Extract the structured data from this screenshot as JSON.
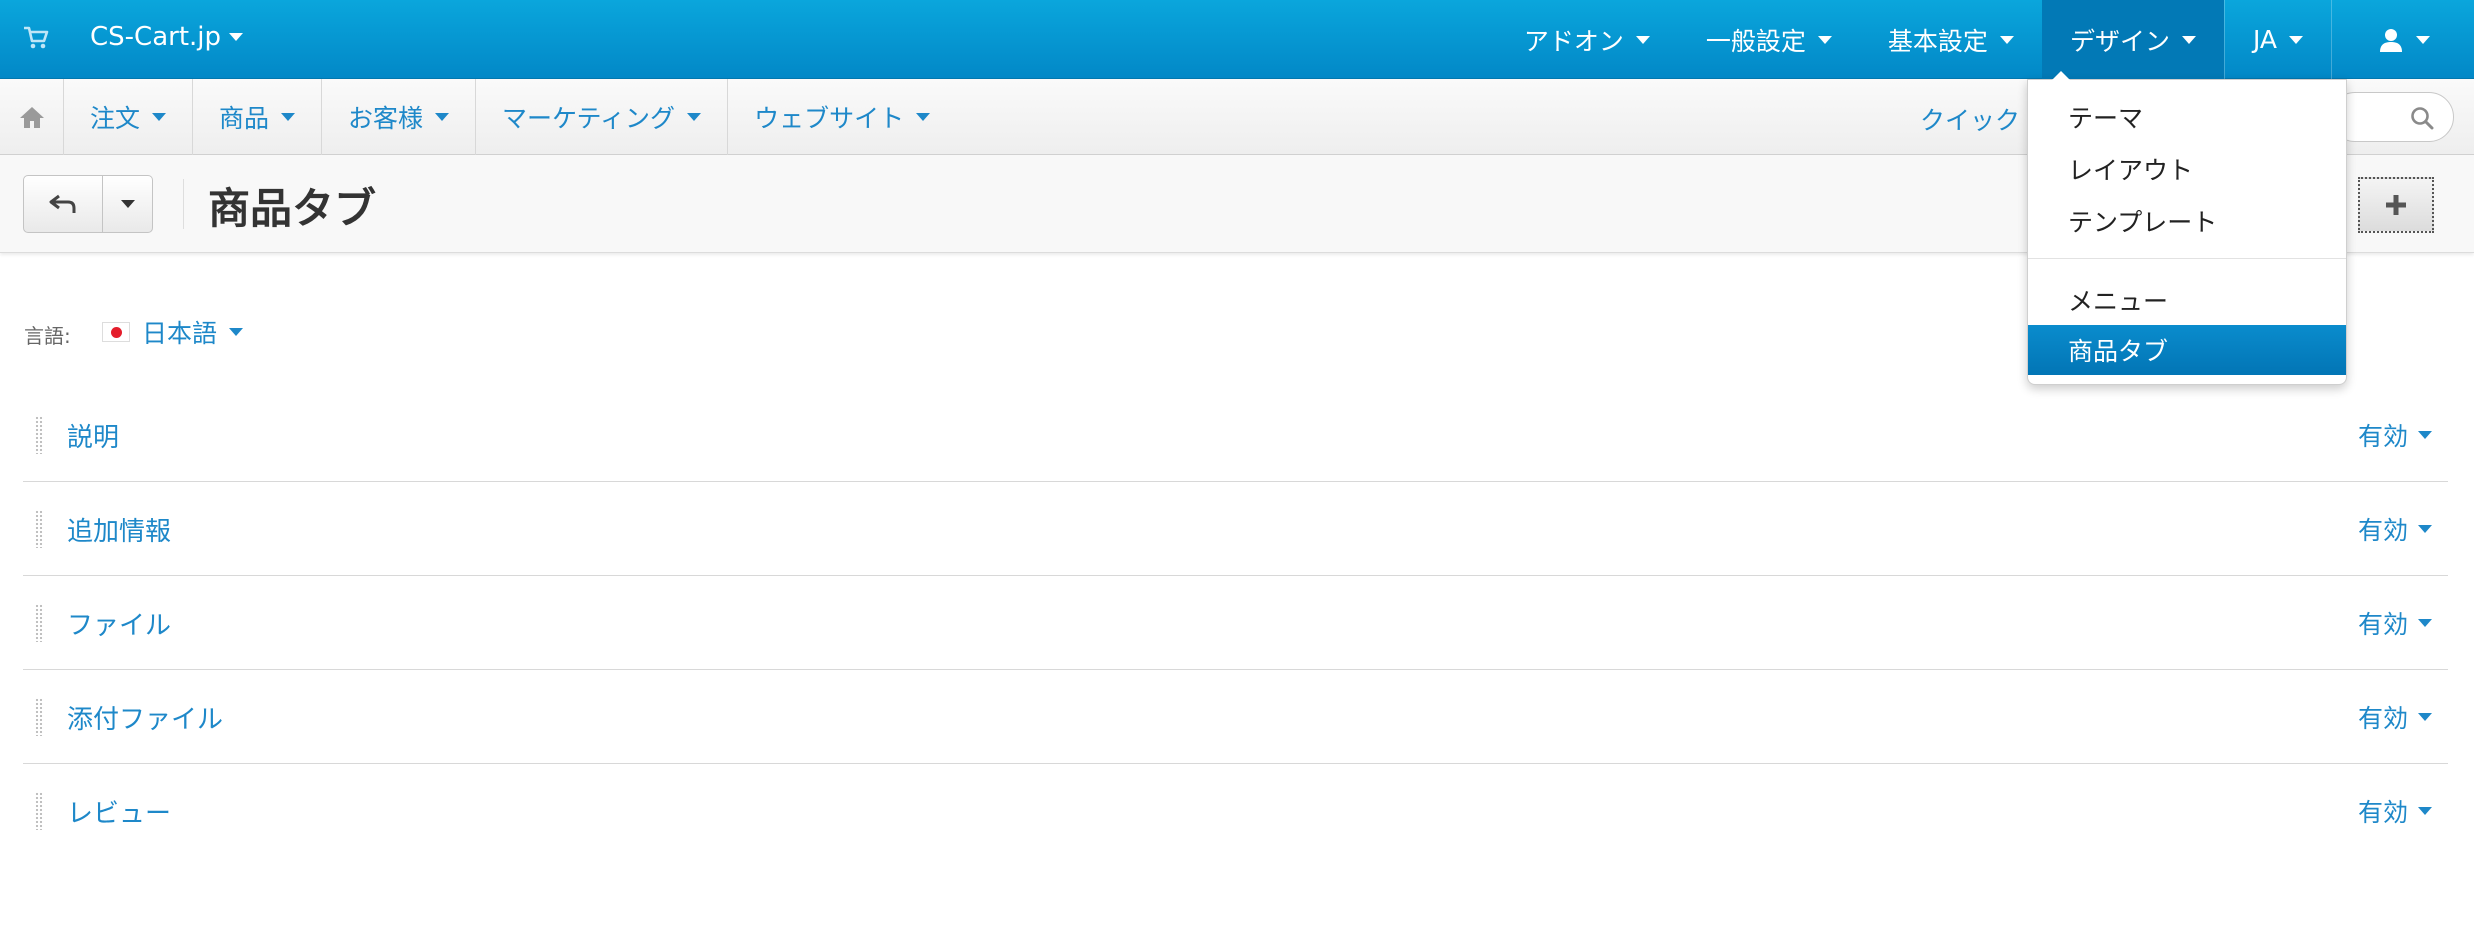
{
  "topbar": {
    "brand": "CS-Cart.jp",
    "menu": [
      {
        "label": "アドオン"
      },
      {
        "label": "一般設定"
      },
      {
        "label": "基本設定"
      },
      {
        "label": "デザイン"
      },
      {
        "label": "JA"
      }
    ]
  },
  "subnav": {
    "items": [
      "注文",
      "商品",
      "お客様",
      "マーケティング",
      "ウェブサイト"
    ],
    "quick_search_label": "クイック"
  },
  "toolbar": {
    "page_title": "商品タブ"
  },
  "language": {
    "label": "言語:",
    "value": "日本語"
  },
  "tabs": [
    {
      "name": "説明",
      "status": "有効"
    },
    {
      "name": "追加情報",
      "status": "有効"
    },
    {
      "name": "ファイル",
      "status": "有効"
    },
    {
      "name": "添付ファイル",
      "status": "有効"
    },
    {
      "name": "レビュー",
      "status": "有効"
    }
  ],
  "design_dropdown": {
    "group1": [
      "テーマ",
      "レイアウト",
      "テンプレート"
    ],
    "group2": [
      "メニュー",
      "商品タブ"
    ],
    "active_item": "商品タブ"
  },
  "colors": {
    "topbar": "#0a9ad4",
    "link": "#1e88c9",
    "active": "#0279b6"
  }
}
